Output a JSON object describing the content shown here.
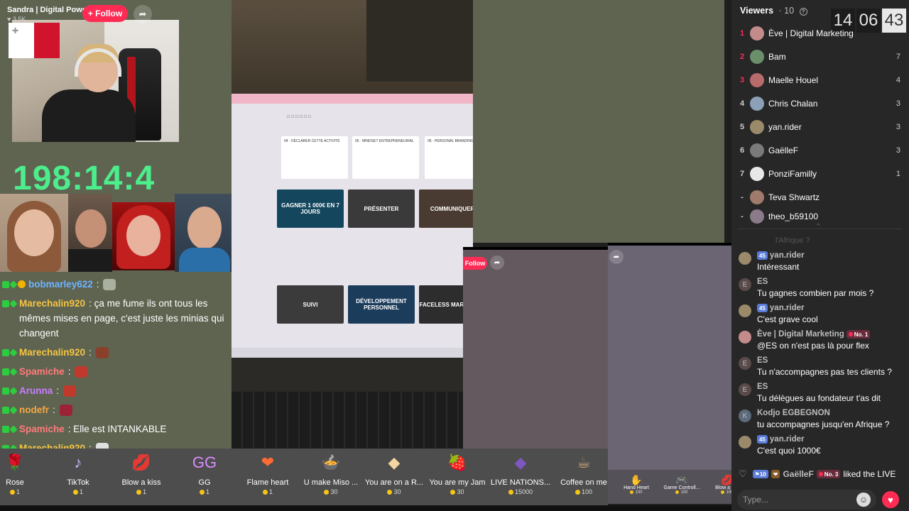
{
  "host": {
    "name": "Sandra | Digital Power",
    "likes": "3.5K",
    "follow_label": "+ Follow",
    "share_icon": "share-arrow-icon"
  },
  "timer": "198:14:4",
  "left_chat": [
    {
      "user": "bobmarley622",
      "text": "",
      "user_color": "#6fb3ff",
      "emote_color": "#a9b0a0",
      "badge_gold": true
    },
    {
      "user": "Marechalin920",
      "text": "ça me fume ils ont tous les mêmes mises en page, c'est juste les minias qui changent",
      "user_color": "#f5c542",
      "emote_color": "",
      "badge_gold": false
    },
    {
      "user": "Marechalin920",
      "text": "",
      "user_color": "#f5c542",
      "emote_color": "#8a3f2b",
      "badge_gold": false
    },
    {
      "user": "Spamiche",
      "text": "",
      "user_color": "#ff7b7b",
      "emote_color": "#c0392b",
      "badge_gold": false
    },
    {
      "user": "Arunna",
      "text": "",
      "user_color": "#c77dff",
      "emote_color": "#c0392b",
      "badge_gold": false
    },
    {
      "user": "nodefr",
      "text": "",
      "user_color": "#f5a742",
      "emote_color": "#9b2335",
      "badge_gold": false
    },
    {
      "user": "Spamiche",
      "text": "Elle est INTANKABLE",
      "user_color": "#ff7b7b",
      "emote_color": "",
      "badge_gold": false
    },
    {
      "user": "Marechalin920",
      "text": "",
      "user_color": "#f5c542",
      "emote_color": "#e0e0e0",
      "badge_gold": false
    }
  ],
  "screen": {
    "cards_top": [
      "04 · DÉCLARER CETTE ACTIVITÉ",
      "05 · MINDSET ENTREPRENEURIAL",
      "06 · PERSONAL BRANDING"
    ],
    "thumbs_mid": [
      "GAGNER 1 000€ EN 7 JOURS",
      "PRÉSENTER",
      "COMMUNIQUER"
    ],
    "thumbs_bot": [
      "SUIVI",
      "DÉVELOPPEMENT PERSONNEL",
      "FACELESS MARKETING"
    ]
  },
  "guest_tile": {
    "follow_label": "Follow"
  },
  "gifts": [
    {
      "name": "Rose",
      "price": "1",
      "icon": "🌹",
      "color": "#e84a5f"
    },
    {
      "name": "TikTok",
      "price": "1",
      "icon": "♪",
      "color": "#c8b5ff"
    },
    {
      "name": "Blow a kiss",
      "price": "1",
      "icon": "💋",
      "color": "#e84a5f"
    },
    {
      "name": "GG",
      "price": "1",
      "icon": "GG",
      "color": "#d98cff"
    },
    {
      "name": "Flame heart",
      "price": "1",
      "icon": "❤",
      "color": "#ff6b35"
    },
    {
      "name": "U make Miso ...",
      "price": "30",
      "icon": "🍲",
      "color": "#d4a017"
    },
    {
      "name": "You are on a R...",
      "price": "30",
      "icon": "◆",
      "color": "#f5d6a0"
    },
    {
      "name": "You are my Jam",
      "price": "30",
      "icon": "🍓",
      "color": "#ff7043"
    },
    {
      "name": "LIVE NATIONS...",
      "price": "15000",
      "icon": "◆",
      "color": "#7e57c2"
    },
    {
      "name": "Coffee on me",
      "price": "100",
      "icon": "☕",
      "color": "#c8a27a"
    }
  ],
  "mini_gifts": [
    {
      "name": "Hand Heart",
      "price": "100",
      "icon": "✋"
    },
    {
      "name": "Game Controll...",
      "price": "100",
      "icon": "🎮"
    },
    {
      "name": "Blow a ki...",
      "price": "100",
      "icon": "💋"
    }
  ],
  "viewers": {
    "title": "Viewers",
    "count": "· 10",
    "clock": [
      "14",
      "06",
      "43"
    ],
    "list": [
      {
        "rank": "1",
        "name": "Ève | Digital Marketing",
        "score": "",
        "color": "#c48b8b"
      },
      {
        "rank": "2",
        "name": "Bam",
        "score": "7",
        "color": "#6b8e6b"
      },
      {
        "rank": "3",
        "name": "Maelle Houel",
        "score": "4",
        "color": "#b86b6b"
      },
      {
        "rank": "4",
        "name": "Chris Chalan",
        "score": "3",
        "color": "#8ca0b8"
      },
      {
        "rank": "5",
        "name": "yan.rider",
        "score": "3",
        "color": "#9a8a6a"
      },
      {
        "rank": "6",
        "name": "GaëlleF",
        "score": "3",
        "color": "#7a7a7a"
      },
      {
        "rank": "7",
        "name": "PonziFamilly",
        "score": "1",
        "color": "#e8e8e8"
      },
      {
        "rank": "-",
        "name": "Teva Shwartz",
        "score": "",
        "color": "#a07a6a"
      },
      {
        "rank": "-",
        "name": "theo_b59100",
        "score": "",
        "color": "#8a7a8a"
      }
    ]
  },
  "faded_text": "l'Afrique ?",
  "right_chat": [
    {
      "user": "yan.rider",
      "lvl": "45",
      "rank": "",
      "text": "Intéressant",
      "avatar": "#9a8a6a",
      "initials": ""
    },
    {
      "user": "ES",
      "lvl": "",
      "rank": "",
      "text": "Tu gagnes combien par mois ?",
      "avatar": "#5a4a4a",
      "initials": "E"
    },
    {
      "user": "yan.rider",
      "lvl": "45",
      "rank": "",
      "text": "C'est grave cool",
      "avatar": "#9a8a6a",
      "initials": ""
    },
    {
      "user": "Ève | Digital Marketing",
      "lvl": "",
      "rank": "No. 1",
      "text": "@ES on n'est pas là pour flex",
      "avatar": "#c48b8b",
      "initials": ""
    },
    {
      "user": "ES",
      "lvl": "",
      "rank": "",
      "text": "Tu n'accompagnes pas tes clients ?",
      "avatar": "#5a4a4a",
      "initials": "E"
    },
    {
      "user": "ES",
      "lvl": "",
      "rank": "",
      "text": "Tu délègues au fondateur t'as dit",
      "avatar": "#5a4a4a",
      "initials": "E"
    },
    {
      "user": "Kodjo EGBEGNON",
      "lvl": "",
      "rank": "",
      "text": "tu accompagnes jusqu'en Afrique ?",
      "avatar": "#5b6b7b",
      "initials": "K"
    },
    {
      "user": "yan.rider",
      "lvl": "45",
      "rank": "",
      "text": "C'est quoi 1000€",
      "avatar": "#9a8a6a",
      "initials": ""
    }
  ],
  "like_event": {
    "lvl": "10",
    "user": "GaëlleF",
    "rank": "No. 3",
    "action": "liked the LIVE"
  },
  "input": {
    "placeholder": "Type..."
  }
}
